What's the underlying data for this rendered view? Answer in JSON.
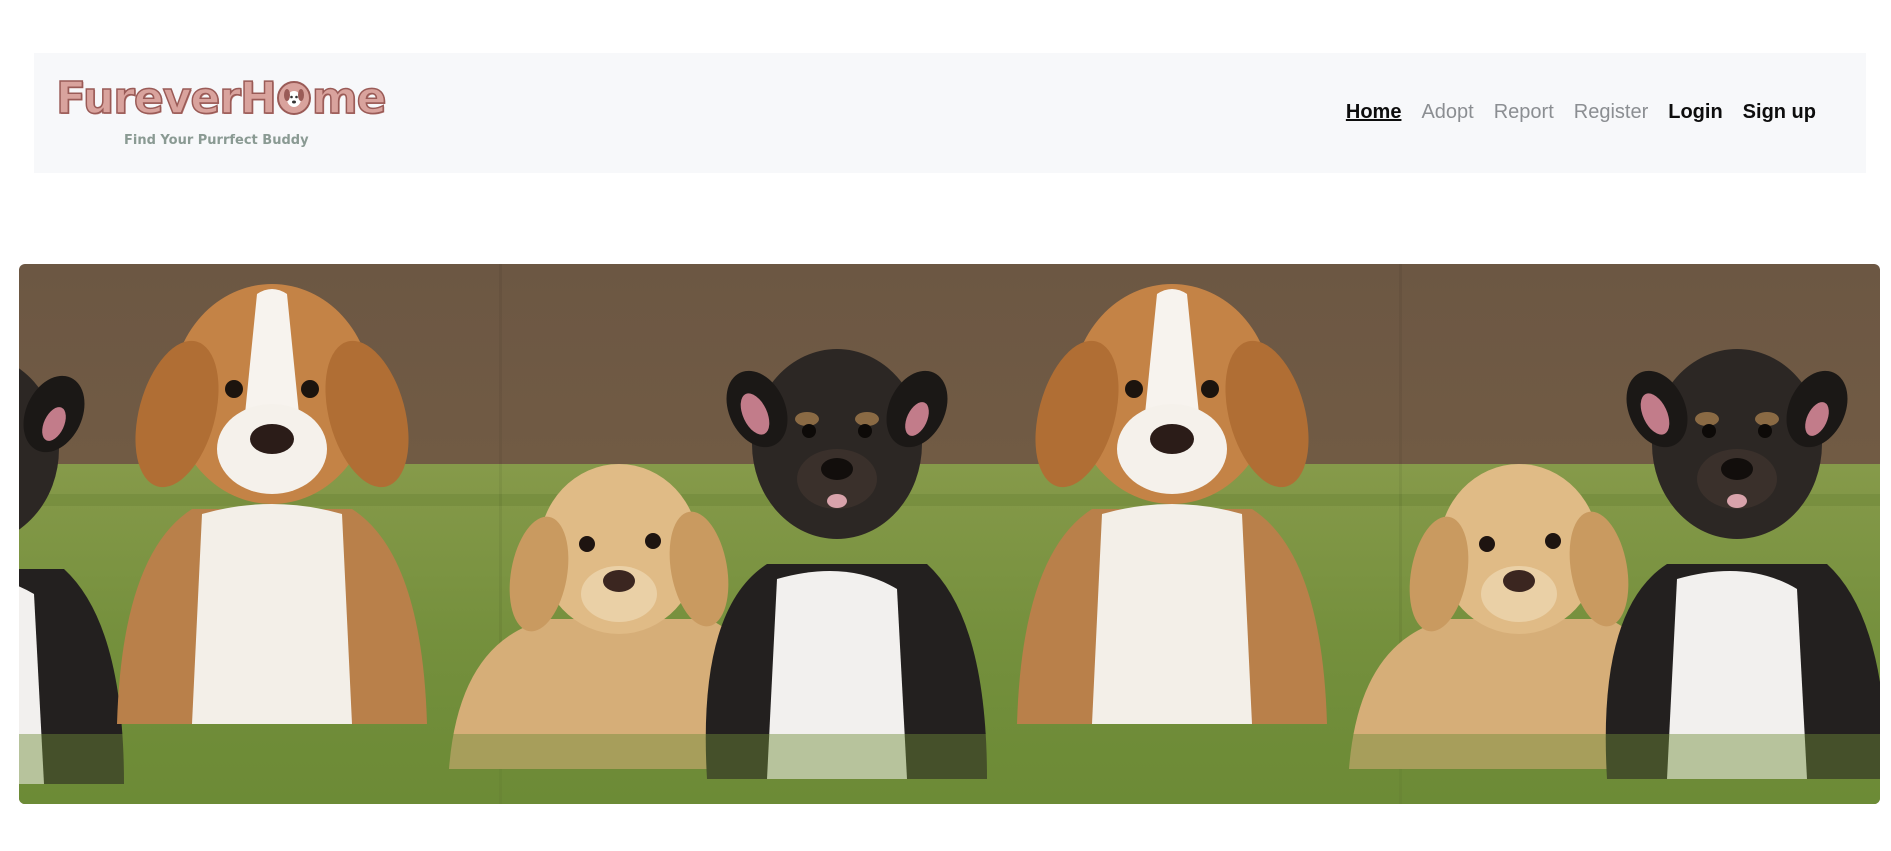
{
  "brand": {
    "title_prefix": "Furever",
    "title_h": "H",
    "title_suffix": "me",
    "tagline": "Find Your Purrfect Buddy",
    "icon": "dog-face-icon"
  },
  "nav": {
    "home": "Home",
    "adopt": "Adopt",
    "report": "Report",
    "register": "Register",
    "login": "Login",
    "signup": "Sign up"
  },
  "hero": {
    "alt": "Puppies sitting on grass",
    "colors": {
      "wall": "#6f5a45",
      "grass": "#78913f"
    }
  }
}
